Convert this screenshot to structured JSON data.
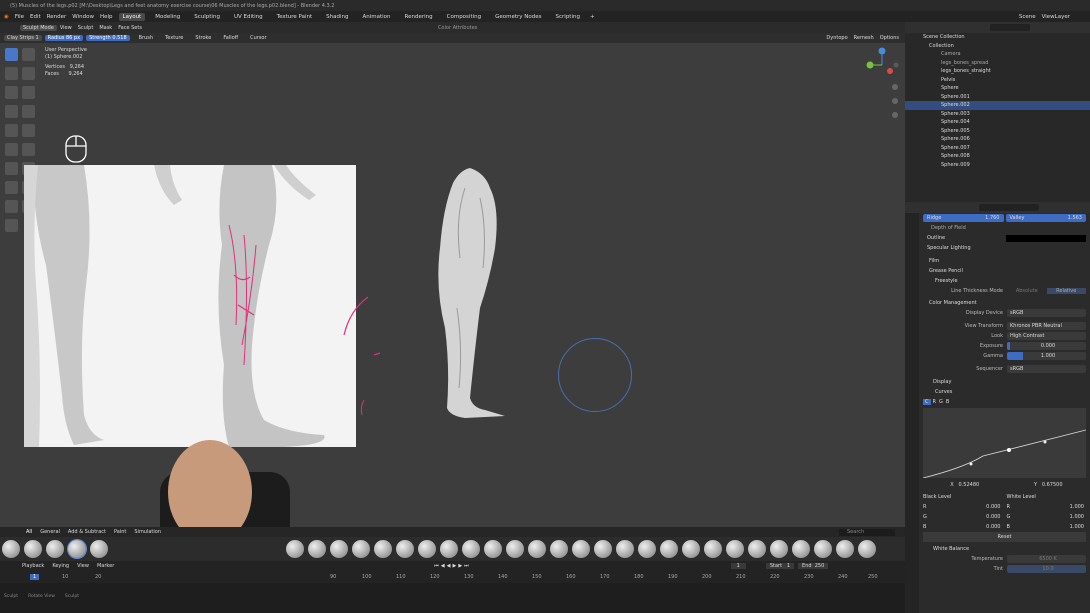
{
  "titlebar": {
    "text": "(5) Muscles of the legs.p02 [M:\\Desktop\\Legs and feet anatomy exercise course\\06 Muscles of the legs.p02.blend] - Blender 4.3.2"
  },
  "menubar": {
    "items": [
      "File",
      "Edit",
      "Render",
      "Window",
      "Help"
    ],
    "workspaces": [
      "Layout",
      "Modeling",
      "Sculpting",
      "UV Editing",
      "Texture Paint",
      "Shading",
      "Animation",
      "Rendering",
      "Compositing",
      "Geometry Nodes",
      "Scripting"
    ],
    "active_workspace": "Layout",
    "scene_label": "Scene",
    "viewlayer_label": "ViewLayer"
  },
  "header1": {
    "mode": "Sculpt Mode",
    "items": [
      "View",
      "Sculpt",
      "Mask",
      "Face Sets"
    ],
    "color_attr": "Color Attributes"
  },
  "header2": {
    "brush_name": "Clay Strips 1",
    "radius_label": "Radius",
    "radius_value": "86 px",
    "strength_label": "Strength",
    "strength_value": "0.518",
    "menus": [
      "Brush",
      "Texture",
      "Stroke",
      "Falloff",
      "Cursor"
    ],
    "right": [
      "Dyntopo",
      "Remesh",
      "Options"
    ]
  },
  "viewport": {
    "perspective": "User Perspective",
    "object": "(1) Sphere.002",
    "vertices_label": "Vertices",
    "vertices_value": "9,264",
    "faces_label": "Faces",
    "faces_value": "9,264"
  },
  "outliner": {
    "root": "Scene Collection",
    "collection": "Collection",
    "items": [
      "Camera",
      "legs_bones_spread",
      "legs_bones_straight",
      "Pelvis",
      "Sphere",
      "Sphere.001",
      "Sphere.002",
      "Sphere.003",
      "Sphere.004",
      "Sphere.005",
      "Sphere.006",
      "Sphere.007",
      "Sphere.008",
      "Sphere.009"
    ],
    "selected": "Sphere.002"
  },
  "properties": {
    "ridge_label": "Ridge",
    "ridge_value": "1.760",
    "valley_label": "Valley",
    "valley_value": "1.563",
    "depth_of_field": "Depth of Field",
    "outline": "Outline",
    "specular": "Specular Lighting",
    "film": "Film",
    "grease": "Grease Pencil",
    "freestyle": "Freestyle",
    "line_thickness": "Line Thickness Mode",
    "absolute": "Absolute",
    "relative": "Relative",
    "color_mgmt": "Color Management",
    "display_device_label": "Display Device",
    "display_device": "sRGB",
    "view_transform_label": "View Transform",
    "view_transform": "Khronos PBR Neutral",
    "look_label": "Look",
    "look": "High Contrast",
    "exposure_label": "Exposure",
    "exposure": "0.000",
    "gamma_label": "Gamma",
    "gamma": "1.000",
    "sequencer_label": "Sequencer",
    "sequencer": "sRGB",
    "display": "Display",
    "curves": "Curves",
    "x_label": "X",
    "x_value": "0.52480",
    "y_label": "Y",
    "y_value": "0.67500",
    "black_level": "Black Level",
    "white_level": "White Level",
    "black_values": [
      "0.000",
      "0.000",
      "0.000"
    ],
    "white_values": [
      "1.000",
      "1.000",
      "1.000"
    ],
    "rgb": [
      "R",
      "G",
      "B"
    ],
    "reset": "Reset",
    "white_balance": "White Balance",
    "temperature_label": "Temperature",
    "temperature_value": "6500 K",
    "tint_label": "Tint",
    "tint_value": "10.0"
  },
  "assetbar": {
    "tabs": [
      "All",
      "General",
      "Add & Subtract",
      "Paint",
      "Simulation"
    ],
    "search": "Search"
  },
  "timeline": {
    "items": [
      "Playback",
      "Keying",
      "View",
      "Marker"
    ],
    "current_frame": "1",
    "start_label": "Start",
    "start": "1",
    "end_label": "End",
    "end": "250",
    "ticks": [
      "1",
      "10",
      "20",
      "90",
      "100",
      "110",
      "120",
      "130",
      "140",
      "150",
      "160",
      "170",
      "180",
      "190",
      "200",
      "210",
      "220",
      "230",
      "240",
      "250"
    ]
  },
  "statusbar": {
    "items": [
      "Sculpt",
      "Rotate View",
      "Sculpt"
    ]
  }
}
